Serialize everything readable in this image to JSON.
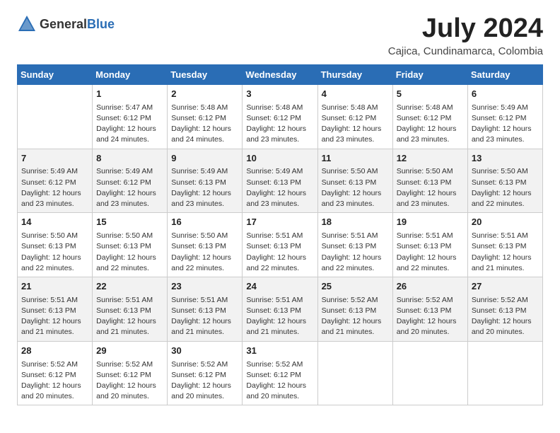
{
  "header": {
    "logo_general": "General",
    "logo_blue": "Blue",
    "month_year": "July 2024",
    "location": "Cajica, Cundinamarca, Colombia"
  },
  "weekdays": [
    "Sunday",
    "Monday",
    "Tuesday",
    "Wednesday",
    "Thursday",
    "Friday",
    "Saturday"
  ],
  "weeks": [
    [
      {
        "day": "",
        "sunrise": "",
        "sunset": "",
        "daylight": ""
      },
      {
        "day": "1",
        "sunrise": "Sunrise: 5:47 AM",
        "sunset": "Sunset: 6:12 PM",
        "daylight": "Daylight: 12 hours and 24 minutes."
      },
      {
        "day": "2",
        "sunrise": "Sunrise: 5:48 AM",
        "sunset": "Sunset: 6:12 PM",
        "daylight": "Daylight: 12 hours and 24 minutes."
      },
      {
        "day": "3",
        "sunrise": "Sunrise: 5:48 AM",
        "sunset": "Sunset: 6:12 PM",
        "daylight": "Daylight: 12 hours and 23 minutes."
      },
      {
        "day": "4",
        "sunrise": "Sunrise: 5:48 AM",
        "sunset": "Sunset: 6:12 PM",
        "daylight": "Daylight: 12 hours and 23 minutes."
      },
      {
        "day": "5",
        "sunrise": "Sunrise: 5:48 AM",
        "sunset": "Sunset: 6:12 PM",
        "daylight": "Daylight: 12 hours and 23 minutes."
      },
      {
        "day": "6",
        "sunrise": "Sunrise: 5:49 AM",
        "sunset": "Sunset: 6:12 PM",
        "daylight": "Daylight: 12 hours and 23 minutes."
      }
    ],
    [
      {
        "day": "7",
        "sunrise": "Sunrise: 5:49 AM",
        "sunset": "Sunset: 6:12 PM",
        "daylight": "Daylight: 12 hours and 23 minutes."
      },
      {
        "day": "8",
        "sunrise": "Sunrise: 5:49 AM",
        "sunset": "Sunset: 6:12 PM",
        "daylight": "Daylight: 12 hours and 23 minutes."
      },
      {
        "day": "9",
        "sunrise": "Sunrise: 5:49 AM",
        "sunset": "Sunset: 6:13 PM",
        "daylight": "Daylight: 12 hours and 23 minutes."
      },
      {
        "day": "10",
        "sunrise": "Sunrise: 5:49 AM",
        "sunset": "Sunset: 6:13 PM",
        "daylight": "Daylight: 12 hours and 23 minutes."
      },
      {
        "day": "11",
        "sunrise": "Sunrise: 5:50 AM",
        "sunset": "Sunset: 6:13 PM",
        "daylight": "Daylight: 12 hours and 23 minutes."
      },
      {
        "day": "12",
        "sunrise": "Sunrise: 5:50 AM",
        "sunset": "Sunset: 6:13 PM",
        "daylight": "Daylight: 12 hours and 23 minutes."
      },
      {
        "day": "13",
        "sunrise": "Sunrise: 5:50 AM",
        "sunset": "Sunset: 6:13 PM",
        "daylight": "Daylight: 12 hours and 22 minutes."
      }
    ],
    [
      {
        "day": "14",
        "sunrise": "Sunrise: 5:50 AM",
        "sunset": "Sunset: 6:13 PM",
        "daylight": "Daylight: 12 hours and 22 minutes."
      },
      {
        "day": "15",
        "sunrise": "Sunrise: 5:50 AM",
        "sunset": "Sunset: 6:13 PM",
        "daylight": "Daylight: 12 hours and 22 minutes."
      },
      {
        "day": "16",
        "sunrise": "Sunrise: 5:50 AM",
        "sunset": "Sunset: 6:13 PM",
        "daylight": "Daylight: 12 hours and 22 minutes."
      },
      {
        "day": "17",
        "sunrise": "Sunrise: 5:51 AM",
        "sunset": "Sunset: 6:13 PM",
        "daylight": "Daylight: 12 hours and 22 minutes."
      },
      {
        "day": "18",
        "sunrise": "Sunrise: 5:51 AM",
        "sunset": "Sunset: 6:13 PM",
        "daylight": "Daylight: 12 hours and 22 minutes."
      },
      {
        "day": "19",
        "sunrise": "Sunrise: 5:51 AM",
        "sunset": "Sunset: 6:13 PM",
        "daylight": "Daylight: 12 hours and 22 minutes."
      },
      {
        "day": "20",
        "sunrise": "Sunrise: 5:51 AM",
        "sunset": "Sunset: 6:13 PM",
        "daylight": "Daylight: 12 hours and 21 minutes."
      }
    ],
    [
      {
        "day": "21",
        "sunrise": "Sunrise: 5:51 AM",
        "sunset": "Sunset: 6:13 PM",
        "daylight": "Daylight: 12 hours and 21 minutes."
      },
      {
        "day": "22",
        "sunrise": "Sunrise: 5:51 AM",
        "sunset": "Sunset: 6:13 PM",
        "daylight": "Daylight: 12 hours and 21 minutes."
      },
      {
        "day": "23",
        "sunrise": "Sunrise: 5:51 AM",
        "sunset": "Sunset: 6:13 PM",
        "daylight": "Daylight: 12 hours and 21 minutes."
      },
      {
        "day": "24",
        "sunrise": "Sunrise: 5:51 AM",
        "sunset": "Sunset: 6:13 PM",
        "daylight": "Daylight: 12 hours and 21 minutes."
      },
      {
        "day": "25",
        "sunrise": "Sunrise: 5:52 AM",
        "sunset": "Sunset: 6:13 PM",
        "daylight": "Daylight: 12 hours and 21 minutes."
      },
      {
        "day": "26",
        "sunrise": "Sunrise: 5:52 AM",
        "sunset": "Sunset: 6:13 PM",
        "daylight": "Daylight: 12 hours and 20 minutes."
      },
      {
        "day": "27",
        "sunrise": "Sunrise: 5:52 AM",
        "sunset": "Sunset: 6:13 PM",
        "daylight": "Daylight: 12 hours and 20 minutes."
      }
    ],
    [
      {
        "day": "28",
        "sunrise": "Sunrise: 5:52 AM",
        "sunset": "Sunset: 6:12 PM",
        "daylight": "Daylight: 12 hours and 20 minutes."
      },
      {
        "day": "29",
        "sunrise": "Sunrise: 5:52 AM",
        "sunset": "Sunset: 6:12 PM",
        "daylight": "Daylight: 12 hours and 20 minutes."
      },
      {
        "day": "30",
        "sunrise": "Sunrise: 5:52 AM",
        "sunset": "Sunset: 6:12 PM",
        "daylight": "Daylight: 12 hours and 20 minutes."
      },
      {
        "day": "31",
        "sunrise": "Sunrise: 5:52 AM",
        "sunset": "Sunset: 6:12 PM",
        "daylight": "Daylight: 12 hours and 20 minutes."
      },
      {
        "day": "",
        "sunrise": "",
        "sunset": "",
        "daylight": ""
      },
      {
        "day": "",
        "sunrise": "",
        "sunset": "",
        "daylight": ""
      },
      {
        "day": "",
        "sunrise": "",
        "sunset": "",
        "daylight": ""
      }
    ]
  ]
}
